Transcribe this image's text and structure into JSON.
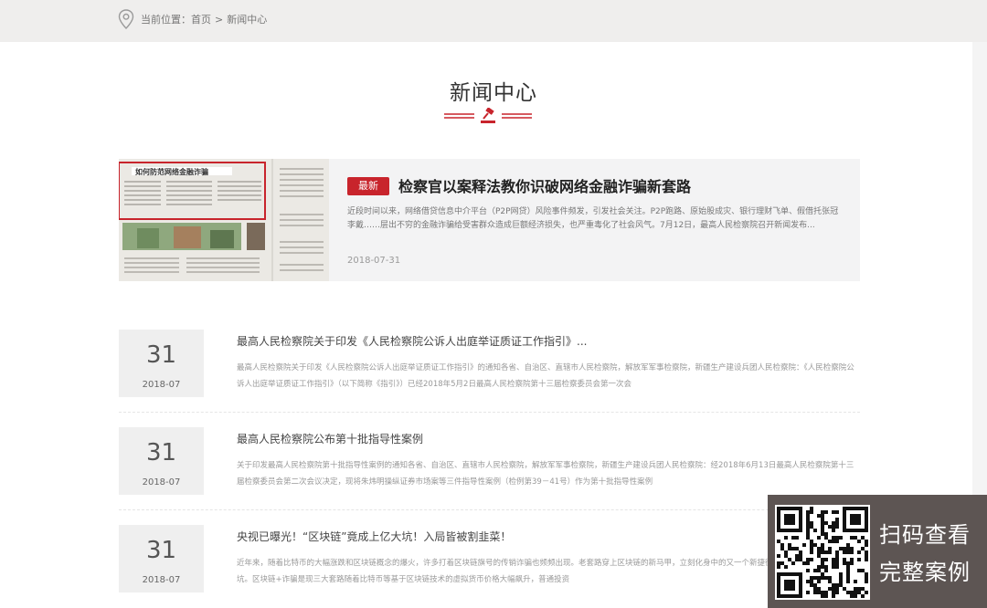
{
  "breadcrumb": {
    "label": "当前位置：",
    "home": "首页",
    "separator": ">",
    "current": "新闻中心",
    "icon": "location-pin-icon"
  },
  "page": {
    "title": "新闻中心",
    "accent_color": "#c8242c",
    "deco_icon": "gavel-icon"
  },
  "featured": {
    "badge": "最新",
    "title": "检察官以案释法教你识破网络金融诈骗新套路",
    "description": "近段时间以来，网络借贷信息中介平台（P2P网贷）风险事件频发，引发社会关注。P2P跑路、原始股成灾、银行理财飞单、假借托张冠李戴……层出不穷的金融诈骗给受害群众造成巨额经济损失，也严重毒化了社会风气。7月12日，最高人民检察院召开新闻发布...",
    "date": "2018-07-31",
    "image_headline": "如何防范网络金融诈骗"
  },
  "news": [
    {
      "day": "31",
      "month": "2018-07",
      "title": "最高人民检察院关于印发《人民检察院公诉人出庭举证质证工作指引》...",
      "description": "最高人民检察院关于印发《人民检察院公诉人出庭举证质证工作指引》的通知各省、自治区、直辖市人民检察院，解放军军事检察院，新疆生产建设兵团人民检察院：《人民检察院公诉人出庭举证质证工作指引》（以下简称《指引》）已经2018年5月2日最高人民检察院第十三届检察委员会第一次会"
    },
    {
      "day": "31",
      "month": "2018-07",
      "title": "最高人民检察院公布第十批指导性案例",
      "description": "关于印发最高人民检察院第十批指导性案例的通知各省、自治区、直辖市人民检察院，解放军军事检察院，新疆生产建设兵团人民检察院：经2018年6月13日最高人民检察院第十三届检察委员会第二次会议决定，现将朱炜明操纵证券市场案等三件指导性案例（检例第39－41号）作为第十批指导性案例"
    },
    {
      "day": "31",
      "month": "2018-07",
      "title": "央视已曝光！“区块链”竟成上亿大坑！入局皆被割韭菜！",
      "description": "近年来，随着比特币的大幅涨跌和区块链概念的爆火，许多打着区块链旗号的传销诈骗也频频出现。老套路穿上区块链的新马甲，立刻化身中的又一个新捷径和一个个价值上亿的大坑。区块链+诈骗是现三大套路随着比特币等基于区块链技术的虚拟货币价格大幅飙升，普通投资"
    }
  ],
  "qr": {
    "line1": "扫码查看",
    "line2": "完整案例",
    "icon": "qr-code-icon"
  }
}
